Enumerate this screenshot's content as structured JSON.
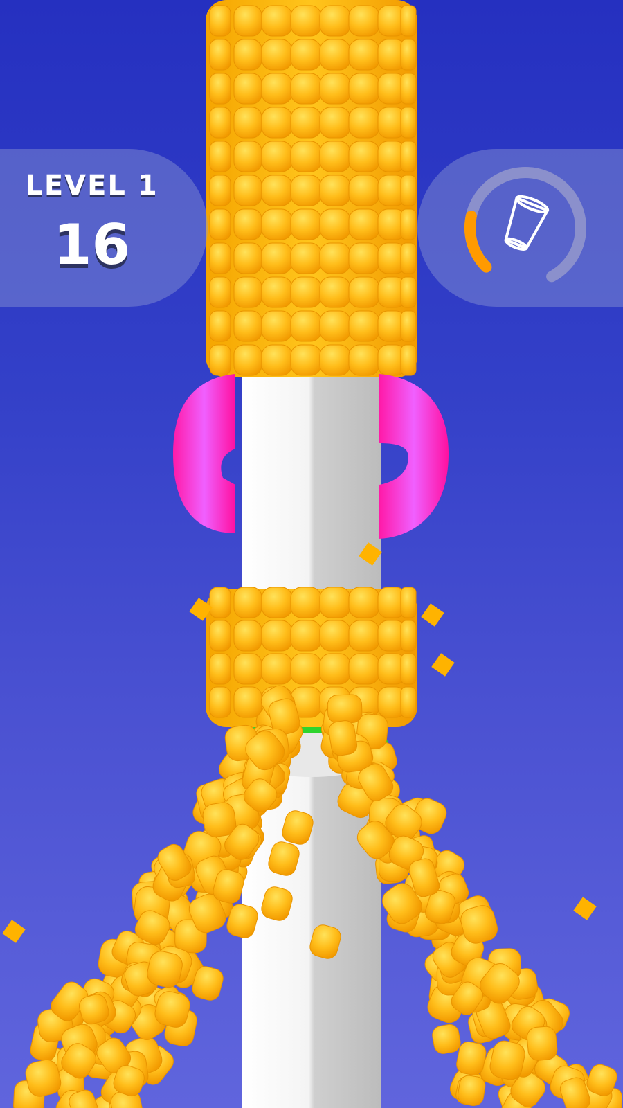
{
  "hud": {
    "level_label": "LEVEL 1",
    "score": "16",
    "cup_progress": 0.2,
    "cup_icon": "cup-icon"
  },
  "colors": {
    "background_top": "#2530c0",
    "background_bottom": "#6065dd",
    "corn": "#ffb716",
    "pole": "#e6e6e6",
    "blade": "#ff1aa0",
    "ring": "#2ed42e",
    "progress": "#ff9a00"
  }
}
